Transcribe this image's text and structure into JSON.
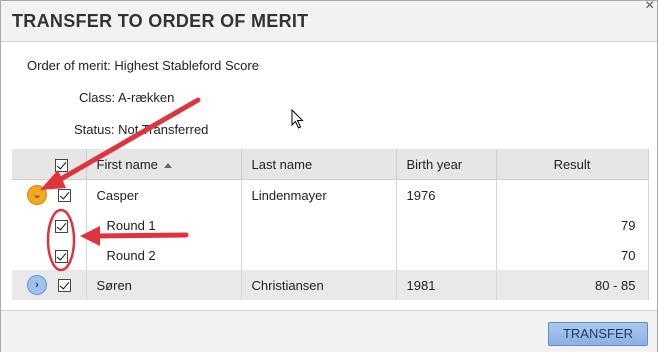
{
  "dialog": {
    "title": "TRANSFER TO ORDER OF MERIT",
    "close": "×"
  },
  "info": {
    "order_label": "Order of merit:",
    "order_value": "Highest Stableford Score",
    "class_label": "Class:",
    "class_value": "A-rækken",
    "status_label": "Status:",
    "status_value": "Not Transferred"
  },
  "table": {
    "headers": [
      "",
      "First name",
      "Last name",
      "Birth year",
      "Result"
    ],
    "rows": [
      {
        "expander": "⌄",
        "first": "Casper",
        "last": "Lindenmayer",
        "birth": "1976",
        "result": ""
      },
      {
        "first": "Round 1",
        "result": "79"
      },
      {
        "first": "Round 2",
        "result": "70"
      },
      {
        "expander": "›",
        "first": "Søren",
        "last": "Christiansen",
        "birth": "1981",
        "result": "80 - 85"
      }
    ]
  },
  "footer": {
    "transfer_label": "TRANSFER"
  },
  "colors": {
    "annotation_red": "#e0343c",
    "expander_open": "#f4a81f",
    "expander_closed": "#9fc3ec",
    "button_blue": "#8bb2e3"
  },
  "icons": {
    "cursor": "mouse-pointer-icon",
    "sort": "sort-ascending-icon"
  }
}
